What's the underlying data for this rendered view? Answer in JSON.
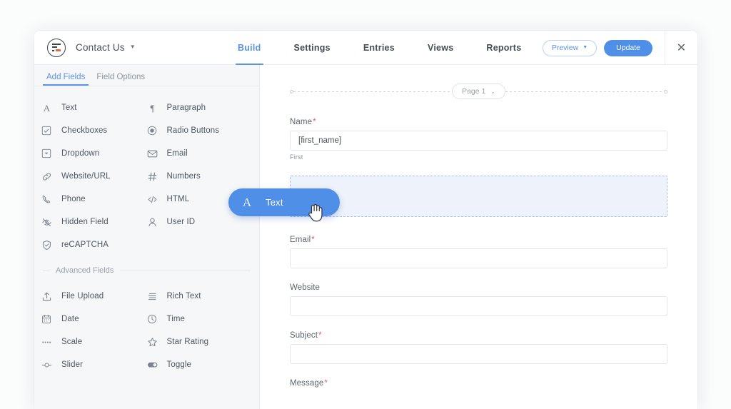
{
  "app": {
    "form_title": "Contact Us",
    "title_caret": "▼",
    "logo_icon": "wpforms-logo-icon"
  },
  "nav": {
    "tabs": [
      {
        "label": "Build",
        "active": true
      },
      {
        "label": "Settings",
        "active": false
      },
      {
        "label": "Entries",
        "active": false
      },
      {
        "label": "Views",
        "active": false
      },
      {
        "label": "Reports",
        "active": false
      }
    ]
  },
  "top_actions": {
    "preview_label": "Preview",
    "preview_caret": "▼",
    "update_label": "Update",
    "close_label": "✕"
  },
  "sidebar": {
    "panel_tabs": [
      {
        "label": "Add Fields",
        "active": true
      },
      {
        "label": "Field Options",
        "active": false
      }
    ],
    "standard_fields": [
      {
        "label": "Text",
        "icon": "letter-a-icon"
      },
      {
        "label": "Paragraph",
        "icon": "pilcrow-icon"
      },
      {
        "label": "Checkboxes",
        "icon": "checkbox-icon"
      },
      {
        "label": "Radio Buttons",
        "icon": "radio-icon"
      },
      {
        "label": "Dropdown",
        "icon": "dropdown-icon"
      },
      {
        "label": "Email",
        "icon": "envelope-icon"
      },
      {
        "label": "Website/URL",
        "icon": "link-icon"
      },
      {
        "label": "Numbers",
        "icon": "hash-icon"
      },
      {
        "label": "Phone",
        "icon": "phone-icon"
      },
      {
        "label": "HTML",
        "icon": "code-icon"
      },
      {
        "label": "Hidden Field",
        "icon": "eye-slash-icon"
      },
      {
        "label": "User ID",
        "icon": "user-icon"
      },
      {
        "label": "reCAPTCHA",
        "icon": "shield-check-icon"
      }
    ],
    "advanced_label": "Advanced Fields",
    "advanced_fields": [
      {
        "label": "File Upload",
        "icon": "upload-icon"
      },
      {
        "label": "Rich Text",
        "icon": "rich-text-icon"
      },
      {
        "label": "Date",
        "icon": "calendar-icon"
      },
      {
        "label": "Time",
        "icon": "clock-icon"
      },
      {
        "label": "Scale",
        "icon": "scale-dots-icon"
      },
      {
        "label": "Star Rating",
        "icon": "star-icon"
      },
      {
        "label": "Slider",
        "icon": "slider-icon"
      },
      {
        "label": "Toggle",
        "icon": "toggle-icon"
      }
    ]
  },
  "preview": {
    "page_pill_label": "Page 1",
    "page_pill_caret": "⌄",
    "fields": [
      {
        "label": "Name",
        "required": true,
        "value": "[first_name]",
        "sub_label": "First"
      },
      {
        "label": "Email",
        "required": true,
        "value": "",
        "sub_label": ""
      },
      {
        "label": "Website",
        "required": false,
        "value": "",
        "sub_label": ""
      },
      {
        "label": "Subject",
        "required": true,
        "value": "",
        "sub_label": ""
      },
      {
        "label": "Message",
        "required": true,
        "value": "",
        "sub_label": ""
      }
    ],
    "required_marker": "*",
    "drop_zone_name": "field-drop-zone"
  },
  "drag_ghost": {
    "icon_glyph": "A",
    "label": "Text"
  },
  "colors": {
    "accent_blue": "#4f8fe8",
    "tab_blue": "#5a93e8",
    "required_red": "#d4636b",
    "sidebar_bg": "#f6f7f8",
    "drop_zone_bg": "#eef3fb",
    "drop_zone_border": "#adbfdb",
    "logo_orange": "#e06a3b"
  }
}
